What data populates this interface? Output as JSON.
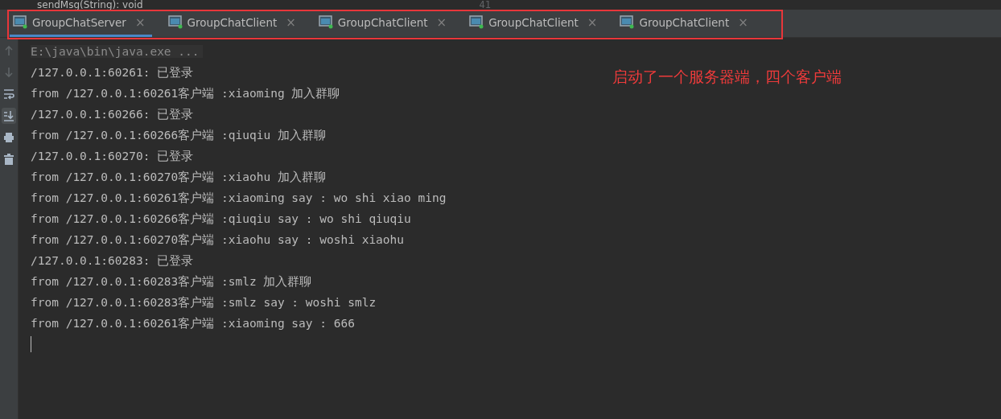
{
  "editor_strip": {
    "method": "sendMsg(String): void",
    "line_number": "41"
  },
  "tabs": [
    {
      "label": "GroupChatServer",
      "close": "×",
      "selected": true
    },
    {
      "label": "GroupChatClient",
      "close": "×",
      "selected": false
    },
    {
      "label": "GroupChatClient",
      "close": "×",
      "selected": false
    },
    {
      "label": "GroupChatClient",
      "close": "×",
      "selected": false
    },
    {
      "label": "GroupChatClient",
      "close": "×",
      "selected": false
    }
  ],
  "toolbar": [
    {
      "kind": "up",
      "on": false
    },
    {
      "kind": "down",
      "on": false
    },
    {
      "kind": "wrap",
      "on": false
    },
    {
      "kind": "scroll",
      "on": true
    },
    {
      "kind": "print",
      "on": false
    },
    {
      "kind": "trash",
      "on": false
    }
  ],
  "console": {
    "command": "E:\\java\\bin\\java.exe ...",
    "lines": [
      "/127.0.0.1:60261: 已登录",
      "from /127.0.0.1:60261客户端 :xiaoming 加入群聊",
      "/127.0.0.1:60266: 已登录",
      "from /127.0.0.1:60266客户端 :qiuqiu 加入群聊",
      "/127.0.0.1:60270: 已登录",
      "from /127.0.0.1:60270客户端 :xiaohu 加入群聊",
      "from /127.0.0.1:60261客户端 :xiaoming say : wo shi xiao ming",
      "from /127.0.0.1:60266客户端 :qiuqiu say : wo shi qiuqiu",
      "from /127.0.0.1:60270客户端 :xiaohu say : woshi xiaohu",
      "/127.0.0.1:60283: 已登录",
      "from /127.0.0.1:60283客户端 :smlz 加入群聊",
      "from /127.0.0.1:60283客户端 :smlz say : woshi smlz",
      "from /127.0.0.1:60261客户端 :xiaoming say : 666"
    ]
  },
  "annotation": "启动了一个服务器端，四个客户端"
}
